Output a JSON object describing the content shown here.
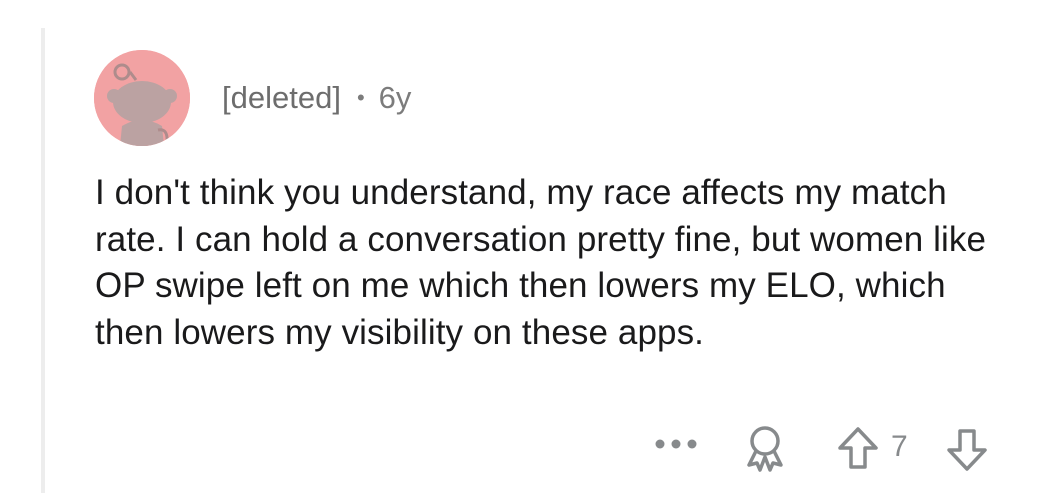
{
  "comment": {
    "author": "[deleted]",
    "separator": "•",
    "age": "6y",
    "body": "I don't think you understand, my race affects my match rate. I can hold a conversation pretty fine, but women like OP swipe left on me which then lowers my ELO, which then lowers my visibility on these apps.",
    "avatar_icon": "snoo-avatar-icon",
    "avatar_color": "#f2a2a3"
  },
  "actions": {
    "more_icon": "more-options-icon",
    "award_icon": "award-icon",
    "upvote_icon": "upvote-arrow-icon",
    "vote_count": "7",
    "downvote_icon": "downvote-arrow-icon"
  }
}
